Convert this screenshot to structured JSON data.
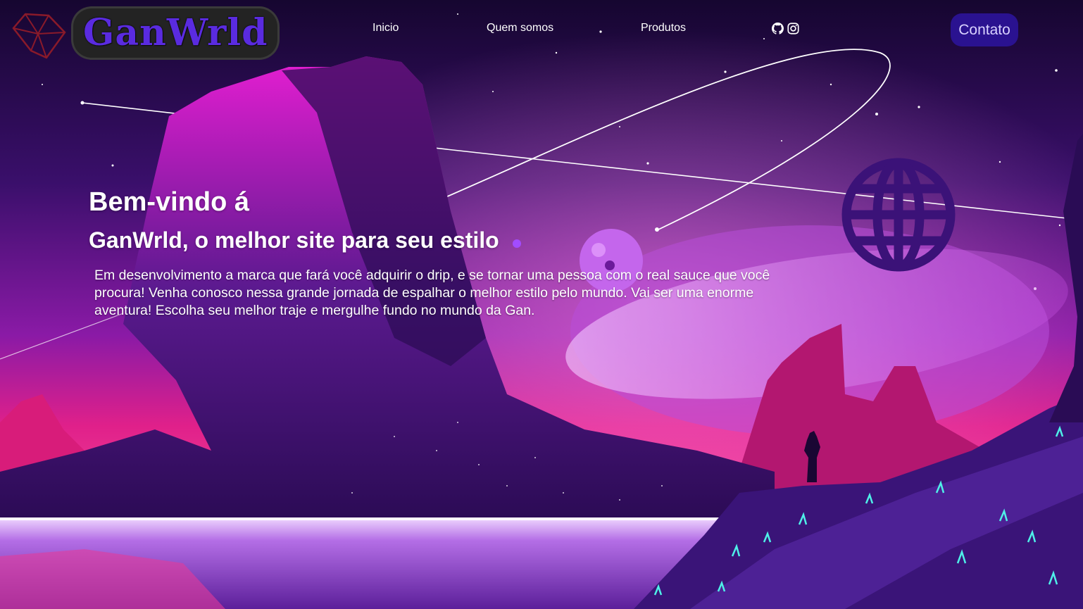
{
  "header": {
    "logo_text": "GanWrld",
    "nav": [
      "Inicio",
      "Quem somos",
      "Produtos"
    ],
    "social_icons": [
      "github-icon",
      "instagram-icon"
    ],
    "contact_label": "Contato"
  },
  "hero": {
    "title": "Bem-vindo á",
    "subtitle": "GanWrld, o melhor site para seu estilo",
    "text": "Em desenvolvimento a marca que fará você adquirir o drip, e se tornar uma pessoa com o real sauce que você procura! Venha conosco nessa grande jornada de espalhar o melhor estilo pelo mundo. Vai ser uma enorme aventura! Escolha seu melhor traje e mergulhe fundo no mundo da Gan."
  },
  "colors": {
    "accent": "#2a1290",
    "logo": "#5a2be0",
    "dot": "#a24cff",
    "sky": "#1a0733",
    "horizon": "#e8208a"
  }
}
